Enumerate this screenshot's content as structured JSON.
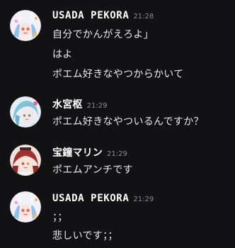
{
  "messages": [
    {
      "author": "USADA PEKORA",
      "time": "21:28",
      "avatar_icon": "pekora-avatar-icon",
      "lines": [
        "自分でかんがえろよ」",
        "はよ",
        "ポエム好きなやつからかいて"
      ]
    },
    {
      "author": "水宮枢",
      "time": "21:29",
      "avatar_icon": "suzu-avatar-icon",
      "lines": [
        "ポエム好きなやついるんですか？"
      ]
    },
    {
      "author": "宝鐘マリン",
      "time": "21:29",
      "avatar_icon": "marine-avatar-icon",
      "lines": [
        "ポエムアンチです"
      ]
    },
    {
      "author": "USADA PEKORA",
      "time": "21:29",
      "avatar_icon": "pekora-avatar-icon",
      "lines": [
        "；；",
        "悲しいです；；"
      ]
    }
  ]
}
